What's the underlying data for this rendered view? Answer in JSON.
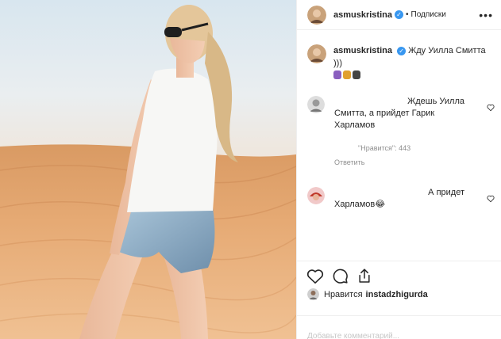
{
  "post": {
    "username": "asmuskristina",
    "verified_mark": "✓",
    "separator": "•",
    "follow_label": "Подписки",
    "more_label": "•••",
    "caption_text": "Жду Уилла Смитта )))",
    "caption_emoji": [
      "woman-emoji",
      "lion-emoji",
      "couple-emoji"
    ]
  },
  "comments": [
    {
      "line1": "Ждешь Уилла",
      "line2": "Смитта, а прийдет Гарик",
      "line3": "Харламов",
      "likes": "\"Нравится\": 443",
      "reply": "Ответить"
    },
    {
      "line1": "А придет",
      "line2": "Харламов😂"
    }
  ],
  "footer": {
    "liked_prefix": "Нравится",
    "liked_user": "instadzhigurda",
    "add_comment_placeholder": "Добавьте комментарий..."
  },
  "colors": {
    "verified": "#3897f0",
    "meta_text": "#8e8e8e",
    "border": "#efefef"
  },
  "icons": [
    "heart-icon",
    "comment-icon",
    "share-icon",
    "more-options-icon",
    "verified-icon"
  ]
}
